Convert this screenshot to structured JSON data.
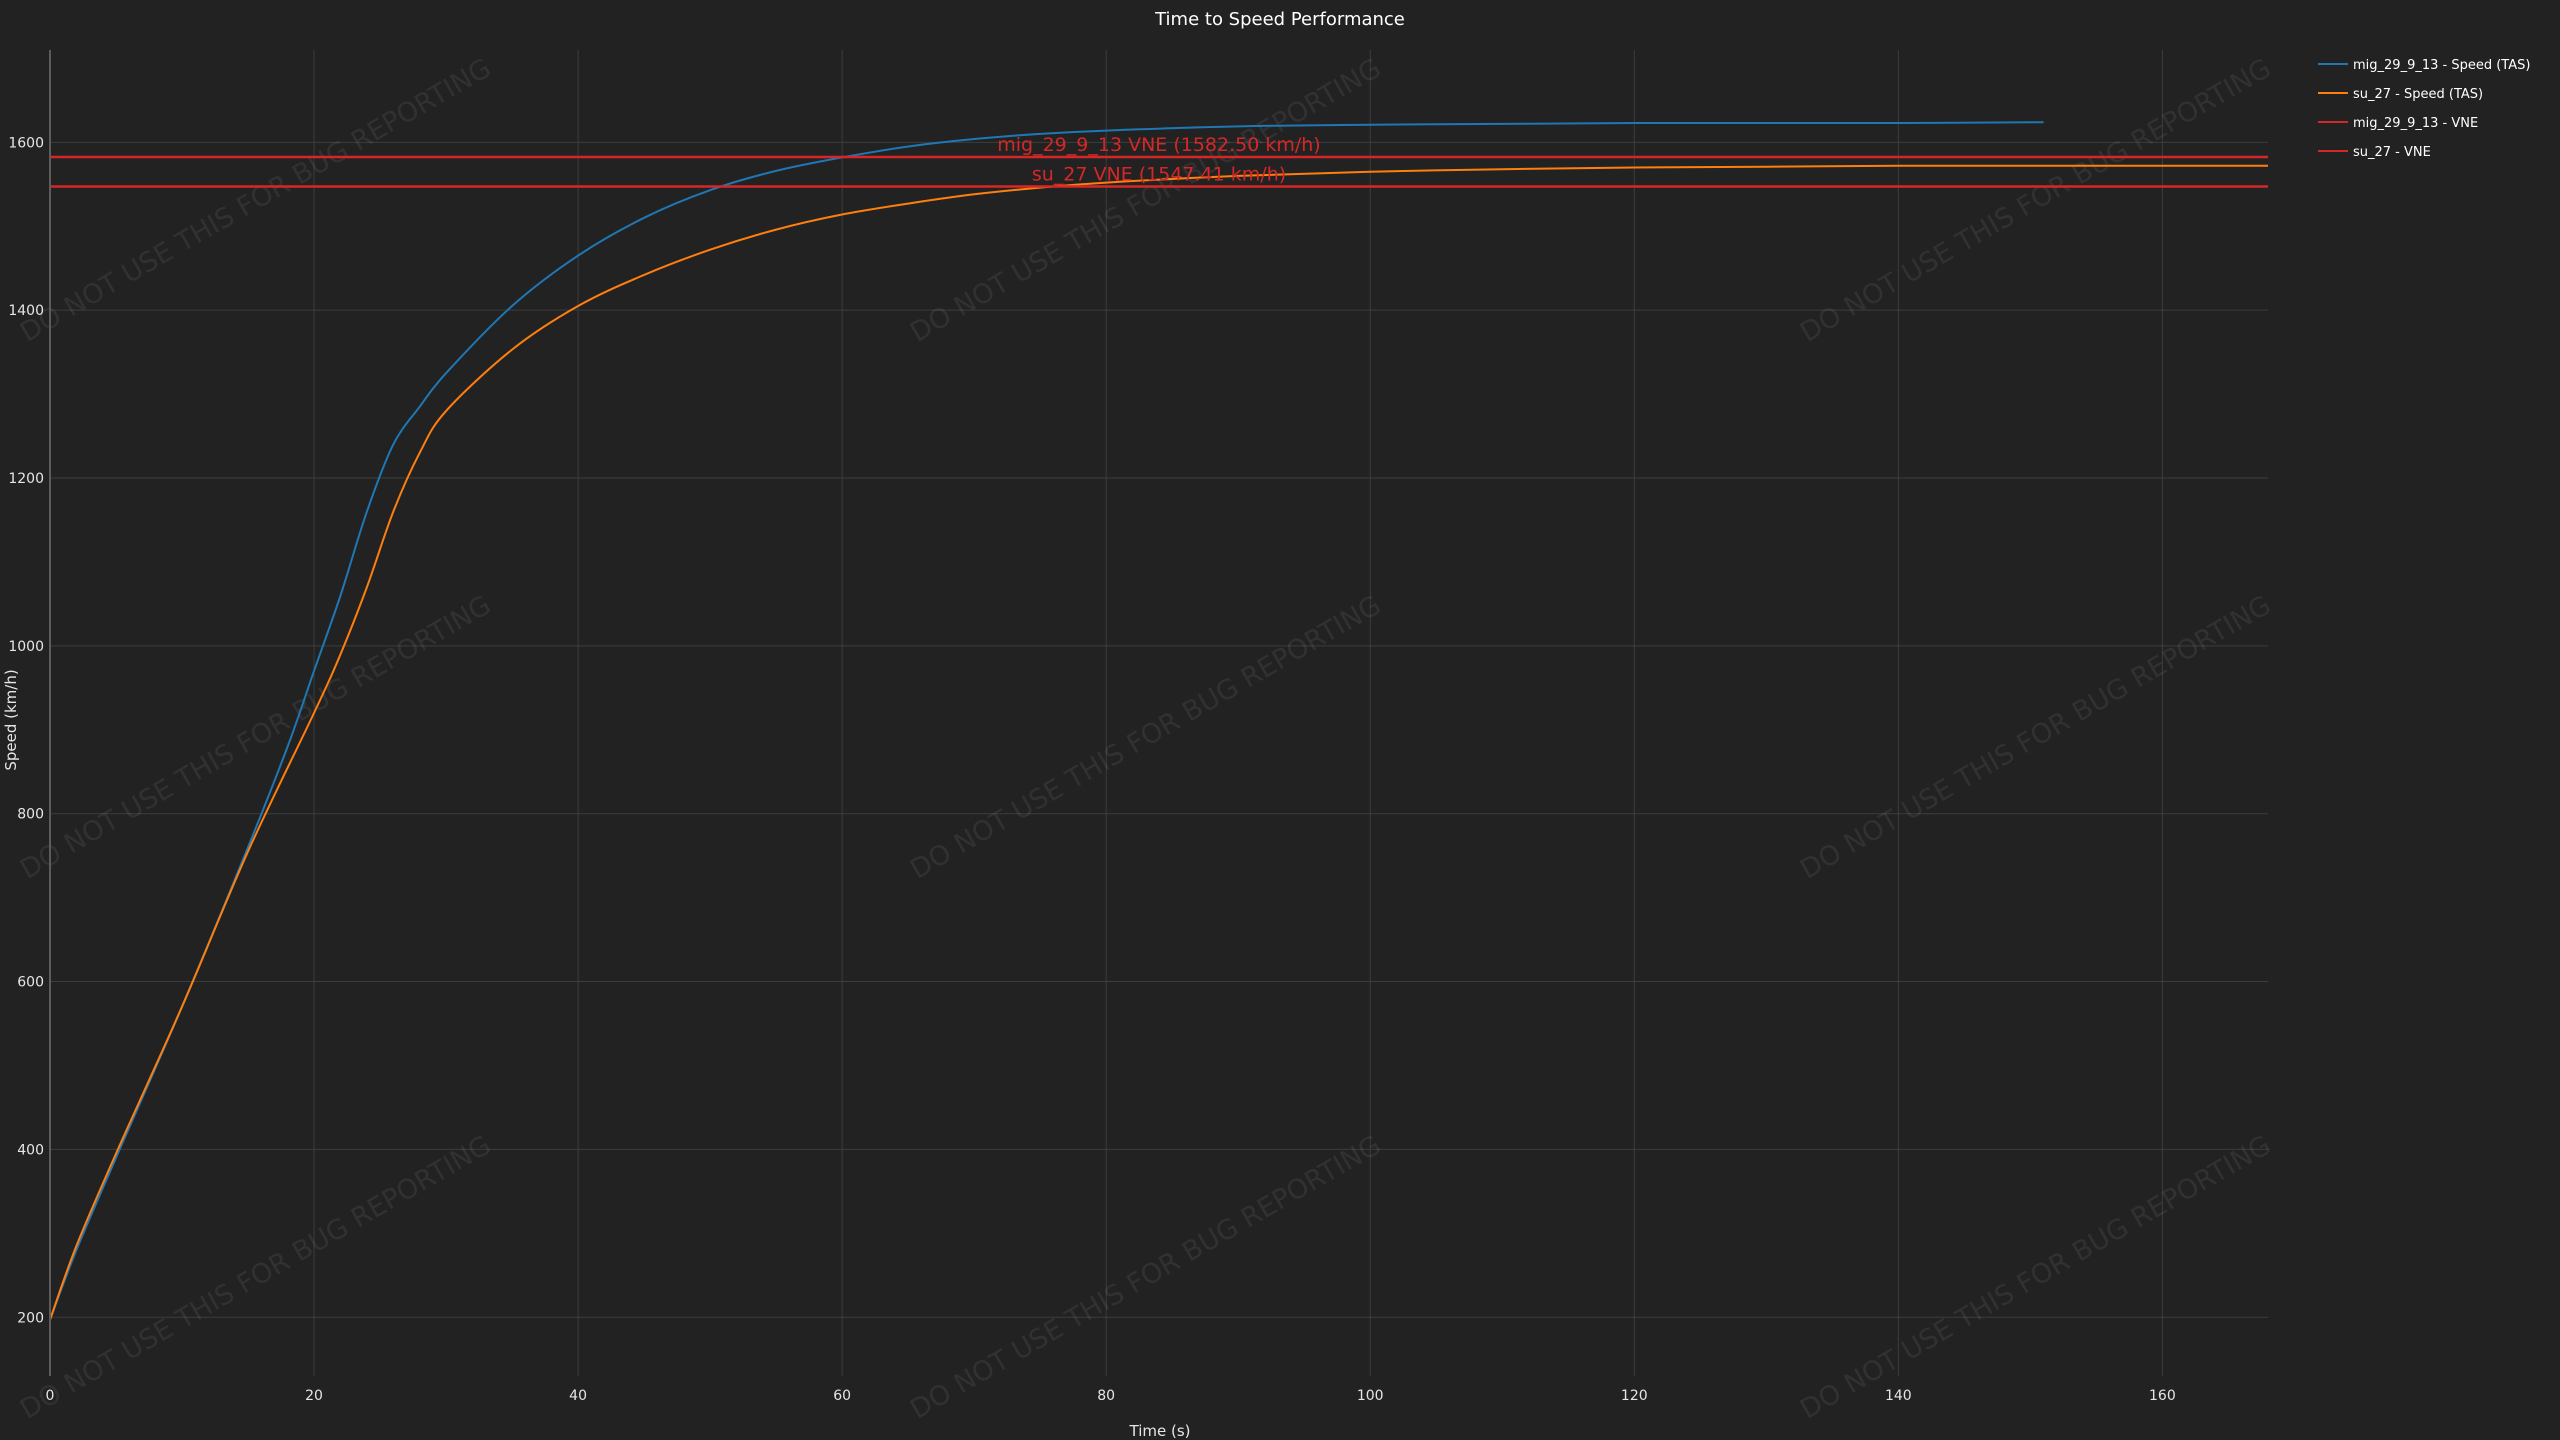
{
  "chart_data": {
    "type": "line",
    "title": "Time to Speed Performance",
    "xlabel": "Time (s)",
    "ylabel": "Speed (km/h)",
    "xlim": [
      0,
      168
    ],
    "ylim": [
      130,
      1710
    ],
    "x_ticks": [
      0,
      20,
      40,
      60,
      80,
      100,
      120,
      140,
      160
    ],
    "y_ticks": [
      200,
      400,
      600,
      800,
      1000,
      1200,
      1400,
      1600
    ],
    "grid": true,
    "background": "#222222",
    "grid_color": "#3d3d3d",
    "legend_position": "right-top",
    "series": [
      {
        "name": "mig_29_9_13 - Speed (TAS)",
        "color": "#1f77b4",
        "x": [
          0,
          2,
          5,
          10,
          15,
          18,
          20,
          22,
          24,
          26,
          28,
          30,
          35,
          40,
          45,
          50,
          55,
          60,
          65,
          70,
          75,
          80,
          90,
          100,
          110,
          120,
          130,
          140,
          151
        ],
        "y": [
          197,
          280,
          390,
          570,
          760,
          880,
          970,
          1060,
          1160,
          1240,
          1285,
          1325,
          1405,
          1465,
          1510,
          1543,
          1566,
          1582,
          1595,
          1604,
          1610,
          1614,
          1619,
          1621,
          1622,
          1623,
          1623,
          1623,
          1624
        ]
      },
      {
        "name": "su_27 - Speed (TAS)",
        "color": "#ff7f0e",
        "x": [
          0,
          2,
          5,
          10,
          15,
          20,
          22,
          24,
          26,
          28,
          30,
          35,
          40,
          45,
          50,
          55,
          60,
          65,
          70,
          75,
          80,
          90,
          100,
          110,
          120,
          130,
          140,
          150,
          160,
          168
        ],
        "y": [
          197,
          285,
          395,
          570,
          755,
          920,
          990,
          1070,
          1160,
          1230,
          1280,
          1353,
          1405,
          1442,
          1472,
          1496,
          1514,
          1527,
          1538,
          1546,
          1552,
          1560,
          1565,
          1568,
          1570,
          1571,
          1572,
          1572,
          1572,
          1572
        ]
      },
      {
        "name": "mig_29_9_13 - VNE",
        "color": "#d62728",
        "x": [
          0,
          168
        ],
        "y": [
          1582.5,
          1582.5
        ]
      },
      {
        "name": "su_27 - VNE",
        "color": "#d62728",
        "x": [
          0,
          168
        ],
        "y": [
          1547.41,
          1547.41
        ]
      }
    ],
    "annotations": [
      {
        "text": "mig_29_9_13 VNE (1582.50 km/h)",
        "x": 84,
        "y": 1582.5,
        "color": "#d62728"
      },
      {
        "text": "su_27 VNE (1547.41 km/h)",
        "x": 84,
        "y": 1547.41,
        "color": "#d62728"
      }
    ],
    "watermark": "DO NOT USE THIS FOR BUG REPORTING"
  }
}
